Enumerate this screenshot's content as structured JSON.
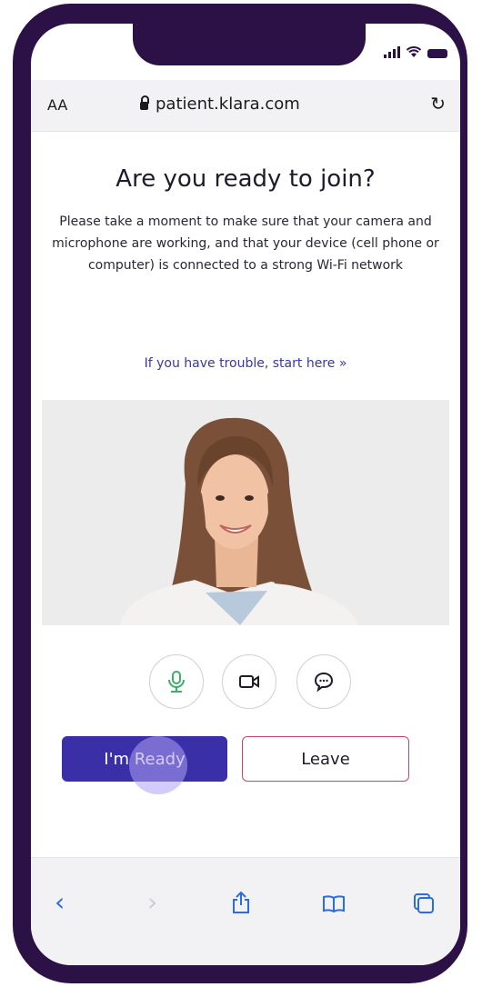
{
  "browser": {
    "text_size_label": "AA",
    "url": "patient.klara.com"
  },
  "page": {
    "title": "Are you ready to join?",
    "description": "Please take a moment to make sure that your camera and microphone are working, and that your device (cell phone or computer) is connected to a strong Wi-Fi network",
    "trouble_link": "If you have trouble, start here »"
  },
  "controls": [
    {
      "icon": "microphone-icon",
      "color": "#3fae6b"
    },
    {
      "icon": "video-camera-icon",
      "color": "#1e1b2a"
    },
    {
      "icon": "chat-icon",
      "color": "#1e1b2a"
    }
  ],
  "buttons": {
    "ready_label": "I'm Ready",
    "leave_label": "Leave"
  },
  "colors": {
    "frame": "#2c1147",
    "primary": "#3a2fa6",
    "leave_border": "#c7436b",
    "link": "#3b35a6",
    "browser_nav": "#2a6be6"
  },
  "bottom_nav": [
    "back-icon",
    "forward-icon",
    "share-icon",
    "bookmarks-icon",
    "tabs-icon"
  ]
}
